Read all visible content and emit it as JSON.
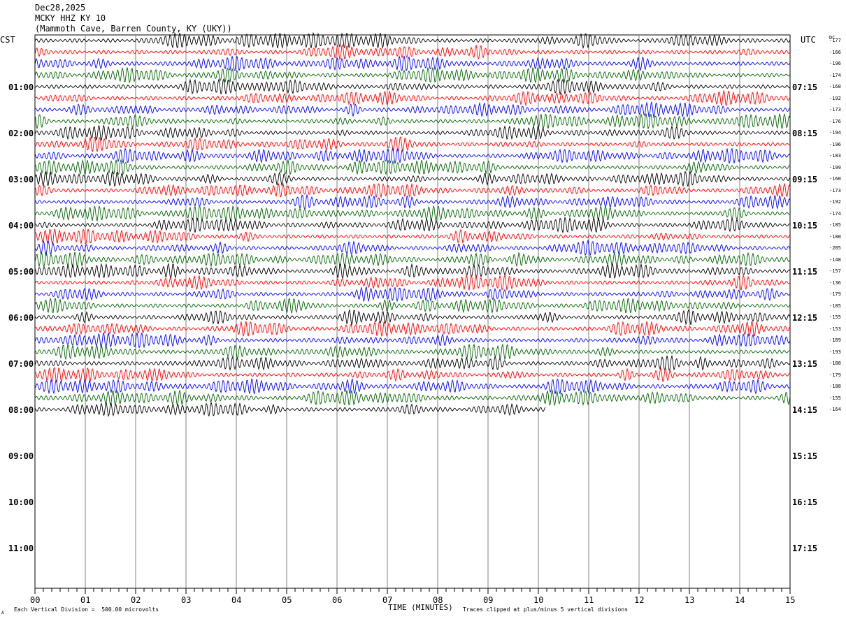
{
  "header": {
    "date": "Dec28,2025",
    "station": "MCKY HHZ KY 10",
    "location": "(Mammoth Cave, Barren County, KY (UKY))"
  },
  "left_timezone": "CST",
  "right_timezone": "UTC",
  "dc_label": "DC",
  "left_hour_labels": [
    "01:00",
    "02:00",
    "03:00",
    "04:00",
    "05:00",
    "06:00",
    "07:00",
    "08:00",
    "09:00",
    "10:00",
    "11:00"
  ],
  "right_hour_labels": [
    "07:15",
    "08:15",
    "09:15",
    "10:15",
    "11:15",
    "12:15",
    "13:15",
    "14:15",
    "15:15",
    "16:15",
    "17:15"
  ],
  "dc_offsets": [
    "-177",
    "-166",
    "-196",
    "-174",
    "-168",
    "-192",
    "-173",
    "-176",
    "-194",
    "-196",
    "-183",
    "-199",
    "-160",
    "-173",
    "-192",
    "-174",
    "-185",
    "-180",
    "-205",
    "-148",
    "-157",
    "-136",
    "-179",
    "-185",
    "-155",
    "-153",
    "-189",
    "-193",
    "-188",
    "-179",
    "-188",
    "-155",
    "-164"
  ],
  "footer": {
    "scale_note": "Each Vertical Division =  500.00 microvolts",
    "axis_title": "TIME (MINUTES)",
    "clip_note": "Traces clipped at plus/minus 5 vertical divisions",
    "corner_mark": "A"
  },
  "chart_data": {
    "type": "line",
    "title": "MCKY HHZ KY 10",
    "xlabel": "TIME (MINUTES)",
    "xlim": [
      0,
      15
    ],
    "x_tick_labels": [
      "00",
      "01",
      "02",
      "03",
      "04",
      "05",
      "06",
      "07",
      "08",
      "09",
      "10",
      "11",
      "12",
      "13",
      "14",
      "15"
    ],
    "grid": true,
    "rows_per_hour": 4,
    "minutes_per_row": 15,
    "trace_count": 33,
    "last_trace_end_minute": 10.15,
    "trace_colors": [
      "#000000",
      "#ff0000",
      "#0000ff",
      "#006400"
    ],
    "series_note": "Each row is a 15-minute helicorder trace; colors cycle black, red, blue, green"
  }
}
